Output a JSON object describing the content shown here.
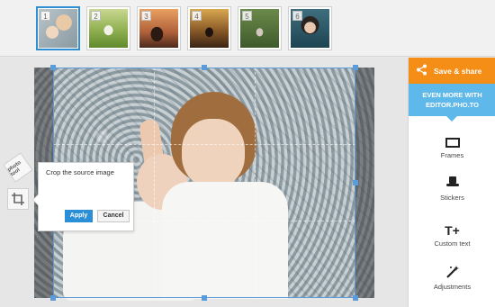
{
  "thumbnails": [
    {
      "number": "1",
      "active": true
    },
    {
      "number": "2",
      "active": false
    },
    {
      "number": "3",
      "active": false
    },
    {
      "number": "4",
      "active": false
    },
    {
      "number": "5",
      "active": false
    },
    {
      "number": "6",
      "active": false
    }
  ],
  "tools": {
    "tag_label": "photo tool",
    "crop_icon": "crop-icon"
  },
  "crop_popup": {
    "title": "Crop the source image",
    "apply_label": "Apply",
    "cancel_label": "Cancel"
  },
  "sidebar": {
    "share_label": "Save & share",
    "promo_line1": "EVEN MORE WITH",
    "promo_line2": "EDITOR.PHO.TO",
    "items": [
      {
        "label": "Frames",
        "icon": "frame-icon"
      },
      {
        "label": "Stickers",
        "icon": "hat-icon"
      },
      {
        "label": "Custom text",
        "icon": "text-icon"
      },
      {
        "label": "Adjustments",
        "icon": "magic-wand-icon"
      }
    ]
  },
  "colors": {
    "accent": "#f58e16",
    "promo": "#5fb8ea",
    "apply": "#2a8fd6",
    "crop_border": "#5b9bd8"
  }
}
